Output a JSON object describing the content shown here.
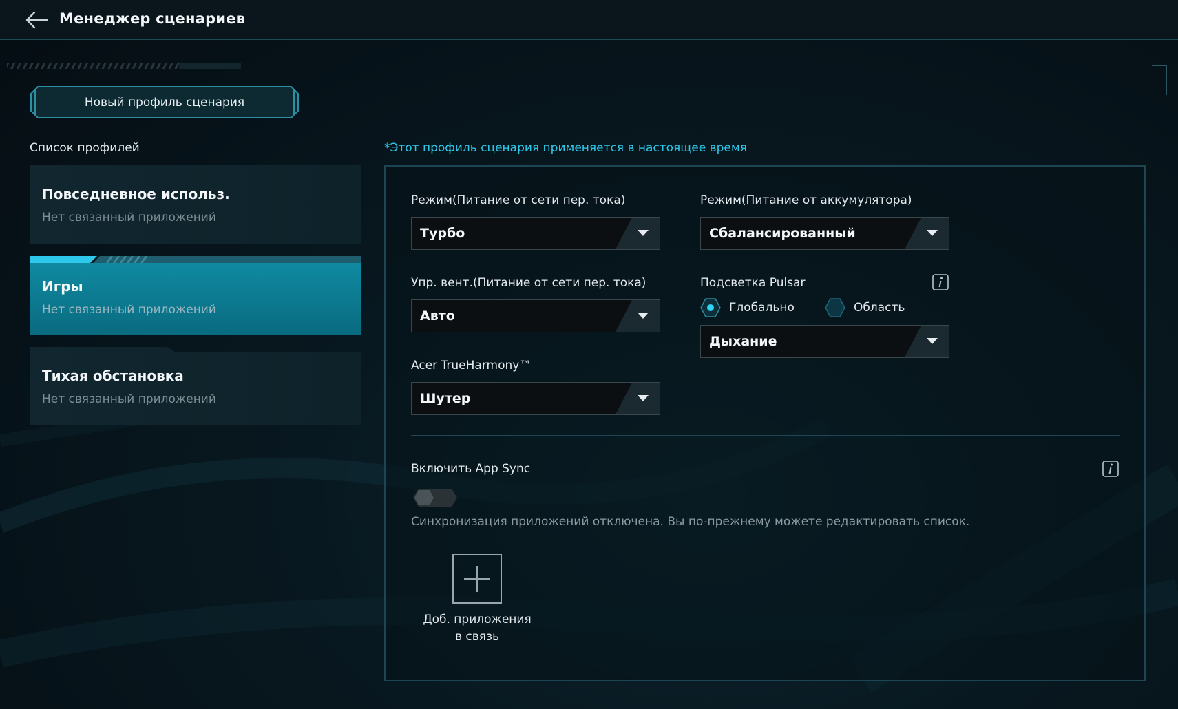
{
  "header": {
    "title": "Менеджер сценариев"
  },
  "new_profile_button": "Новый профиль сценария",
  "profiles_label": "Список профилей",
  "profiles": [
    {
      "name": "Повседневное использ.",
      "subtitle": "Нет связанный приложений",
      "active": false
    },
    {
      "name": "Игры",
      "subtitle": "Нет связанный приложений",
      "active": true
    },
    {
      "name": "Тихая обстановка",
      "subtitle": "Нет связанный приложений",
      "active": false
    }
  ],
  "applied_note": "*Этот профиль сценария применяется в настоящее время",
  "settings": {
    "mode_ac": {
      "label": "Режим(Питание от сети пер. тока)",
      "value": "Турбо"
    },
    "mode_battery": {
      "label": "Режим(Питание от аккумулятора)",
      "value": "Сбалансированный"
    },
    "fan_ac": {
      "label": "Упр. вент.(Питание от сети пер. тока)",
      "value": "Авто"
    },
    "pulsar": {
      "label": "Подсветка Pulsar",
      "options": [
        "Глобально",
        "Область"
      ],
      "selected": "Глобально",
      "effect": "Дыхание"
    },
    "true_harmony": {
      "label": "Acer TrueHarmony™",
      "value": "Шутер"
    }
  },
  "app_sync": {
    "label": "Включить App Sync",
    "enabled": false,
    "note": "Синхронизация приложений отключена. Вы по-прежнему можете редактировать список."
  },
  "add_app": {
    "line1": "Доб. приложения",
    "line2": "в связь"
  },
  "colors": {
    "accent": "#0f8aa1",
    "accent_text": "#2ec9ea",
    "panel_border": "#1e4552",
    "background": "#060d12"
  }
}
